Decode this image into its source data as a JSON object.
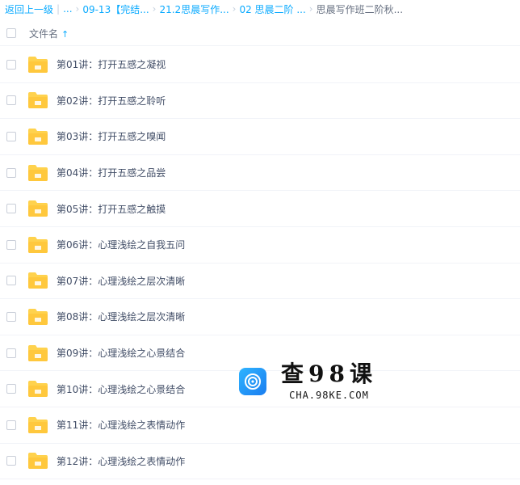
{
  "breadcrumb": {
    "back": "返回上一级",
    "sep": "|",
    "ellipsis": "...",
    "items": [
      "09-13【完结...",
      "21.2思晨写作...",
      "02 思晨二阶 ..."
    ],
    "current": "思晨写作班二阶秋..."
  },
  "header": {
    "file_name_col": "文件名",
    "sort_arrow": "↑"
  },
  "files": [
    "第01讲：打开五感之凝视",
    "第02讲：打开五感之聆听",
    "第03讲：打开五感之嗅闻",
    "第04讲：打开五感之品尝",
    "第05讲：打开五感之触摸",
    "第06讲：心理浅绘之自我五问",
    "第07讲：心理浅绘之层次清晰",
    "第08讲：心理浅绘之层次清晰",
    "第09讲：心理浅绘之心景结合",
    "第10讲：心理浅绘之心景结合",
    "第11讲：心理浅绘之表情动作",
    "第12讲：心理浅绘之表情动作"
  ],
  "watermark": {
    "title": "查98课",
    "url": "CHA.98KE.COM"
  },
  "colors": {
    "accent": "#09aaff",
    "folder": "#ffd24d",
    "text": "#424e67"
  }
}
